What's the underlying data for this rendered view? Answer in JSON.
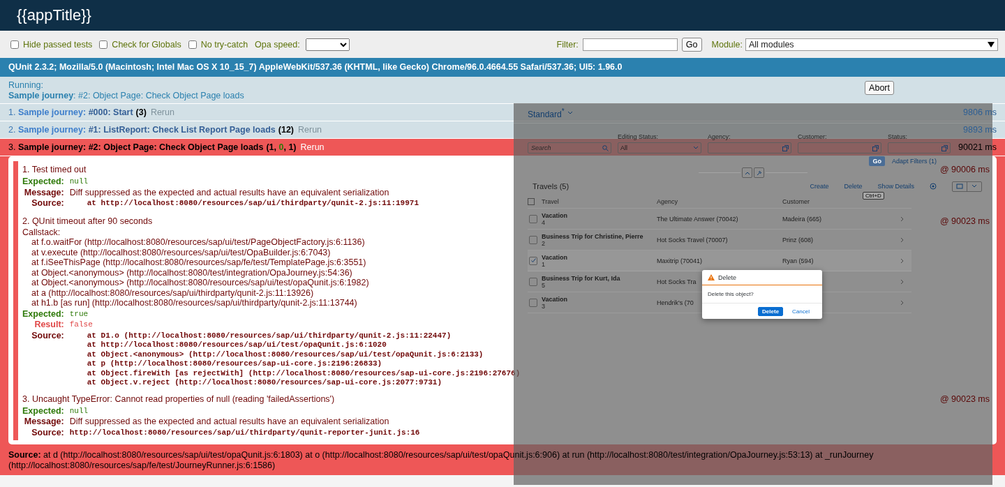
{
  "header": {
    "title": "{{appTitle}}"
  },
  "toolbar": {
    "options": [
      {
        "label": "Hide passed tests",
        "checked": false
      },
      {
        "label": "Check for Globals",
        "checked": false
      },
      {
        "label": "No try-catch",
        "checked": false
      }
    ],
    "speed_label": "Opa speed:",
    "filter_label": "Filter:",
    "filter_button": "Go",
    "module_label": "Module:",
    "module_value": "All modules"
  },
  "banner": {
    "user_agent": "QUnit 2.3.2; Mozilla/5.0 (Macintosh; Intel Mac OS X 10_15_7) AppleWebKit/537.36 (KHTML, like Gecko) Chrome/96.0.4664.55 Safari/537.36; UI5: 1.96.0"
  },
  "running": {
    "label": "Running:",
    "text": "**Sample journey**: #2: Object Page: Check Object Page loads",
    "abort_button": "Abort"
  },
  "tests": [
    {
      "number": "1.",
      "module": "Sample journey:",
      "name": "#000: Start",
      "counts": [
        {
          "text": "(3)",
          "kind": "total"
        }
      ],
      "rerun": "Rerun",
      "time": "9806 ms",
      "failed": false
    },
    {
      "number": "2.",
      "module": "Sample journey:",
      "name": "#1: ListReport: Check List Report Page loads",
      "counts": [
        {
          "text": "(12)",
          "kind": "total"
        }
      ],
      "rerun": "Rerun",
      "time": "9893 ms",
      "failed": false
    },
    {
      "number": "3.",
      "module": "Sample journey:",
      "name": "#2: Object Page: Check Object Page loads",
      "counts": [
        {
          "text": "(1, ",
          "kind": "failed"
        },
        {
          "text": "0",
          "kind": "passed"
        },
        {
          "text": ", 1)",
          "kind": "total"
        }
      ],
      "rerun": "Rerun",
      "time": "90021 ms",
      "failed": true,
      "assertions": [
        {
          "title": "1. Test timed out",
          "time": "@ 90006 ms",
          "fields": [
            {
              "kind": "expected",
              "label": "Expected:",
              "lines": [
                "null"
              ]
            },
            {
              "kind": "message",
              "label": "Message:",
              "lines": [
                "Diff suppressed as the expected and actual results have an equivalent serialization"
              ]
            },
            {
              "kind": "source",
              "label": "Source:",
              "indented": true,
              "lines": [
                "at http://localhost:8080/resources/sap/ui/thirdparty/qunit-2.js:11:19971"
              ]
            }
          ]
        },
        {
          "title": "2. QUnit timeout after 90 seconds",
          "time": "@ 90023 ms",
          "callstack_label": "Callstack:",
          "callstack": [
            "at f.o.waitFor (http://localhost:8080/resources/sap/ui/test/PageObjectFactory.js:6:1136)",
            "at v.execute (http://localhost:8080/resources/sap/ui/test/OpaBuilder.js:6:7043)",
            "at f.iSeeThisPage (http://localhost:8080/resources/sap/fe/test/TemplatePage.js:6:3551)",
            "at Object.<anonymous> (http://localhost:8080/test/integration/OpaJourney.js:54:36)",
            "at Object.<anonymous> (http://localhost:8080/resources/sap/ui/test/opaQunit.js:6:1982)",
            "at a (http://localhost:8080/resources/sap/ui/thirdparty/qunit-2.js:11:13926)",
            "at h1.b [as run] (http://localhost:8080/resources/sap/ui/thirdparty/qunit-2.js:11:13744)"
          ],
          "fields": [
            {
              "kind": "expected",
              "label": "Expected:",
              "lines": [
                "true"
              ]
            },
            {
              "kind": "result",
              "label": "Result:",
              "lines": [
                "false"
              ]
            },
            {
              "kind": "source",
              "label": "Source:",
              "indented": true,
              "lines": [
                "at D1.o (http://localhost:8080/resources/sap/ui/thirdparty/qunit-2.js:11:22447)",
                "at http://localhost:8080/resources/sap/ui/test/opaQunit.js:6:1020",
                "at Object.<anonymous> (http://localhost:8080/resources/sap/ui/test/opaQunit.js:6:2133)",
                "at p (http://localhost:8080/resources/sap-ui-core.js:2196:26833)",
                "at Object.fireWith [as rejectWith] (http://localhost:8080/resources/sap-ui-core.js:2196:27676)",
                "at Object.v.reject (http://localhost:8080/resources/sap-ui-core.js:2077:9731)"
              ]
            }
          ]
        },
        {
          "title": "3. Uncaught TypeError: Cannot read properties of null (reading 'failedAssertions')",
          "time": "@ 90023 ms",
          "fields": [
            {
              "kind": "expected",
              "label": "Expected:",
              "lines": [
                "null"
              ]
            },
            {
              "kind": "message",
              "label": "Message:",
              "lines": [
                "Diff suppressed as the expected and actual results have an equivalent serialization"
              ]
            },
            {
              "kind": "source",
              "label": "Source:",
              "indented": false,
              "lines": [
                "http://localhost:8080/resources/sap/ui/thirdparty/qunit-reporter-junit.js:16"
              ]
            }
          ]
        }
      ],
      "source": {
        "label": "Source:",
        "text": "at d (http://localhost:8080/resources/sap/ui/test/opaQunit.js:6:1803) at o (http://localhost:8080/resources/sap/ui/test/opaQunit.js:6:906) at run (http://localhost:8080/test/integration/OpaJourney.js:53:13) at _runJourney (http://localhost:8080/resources/sap/fe/test/JourneyRunner.js:6:1586)"
      }
    }
  ],
  "app": {
    "variant": "Standard$^{*}$",
    "filters": [
      {
        "kind": "search",
        "placeholder": "Search"
      },
      {
        "kind": "select",
        "label": "Editing Status:",
        "value": "All"
      },
      {
        "kind": "valuehelp",
        "label": "Agency:"
      },
      {
        "kind": "valuehelp",
        "label": "Customer:"
      },
      {
        "kind": "valuehelp",
        "label": "Status:"
      }
    ],
    "go_button": "Go",
    "adapt_filters": "Adapt Filters (1)",
    "table": {
      "title": "Travels (5)",
      "actions": [
        "Create",
        "Delete",
        "Show Details"
      ],
      "tooltip": "Ctrl+D",
      "columns": [
        "Travel",
        "Agency",
        "Customer"
      ],
      "rows": [
        {
          "title": "Vacation",
          "id": "4",
          "agency": "The Ultimate Answer (70042)",
          "customer": "Madeira (665)",
          "checked": false
        },
        {
          "title": "Business Trip for Christine, Pierre",
          "id": "2",
          "agency": "Hot Socks Travel (70007)",
          "customer": "Prinz (608)",
          "checked": false
        },
        {
          "title": "Vacation",
          "id": "1",
          "agency": "Maxitrip (70041)",
          "customer": "Ryan (594)",
          "checked": true
        },
        {
          "title": "Business Trip for Kurt, Ida",
          "id": "5",
          "agency": "Hot Socks Tra",
          "checked": false
        },
        {
          "title": "Vacation",
          "id": "3",
          "agency": "Hendrik's (70",
          "checked": false
        }
      ]
    },
    "dialog": {
      "title": "Delete",
      "message": "Delete this object?",
      "buttons": [
        {
          "label": "Delete",
          "kind": "emphasized"
        },
        {
          "label": "Cancel",
          "kind": "transparent"
        }
      ]
    }
  }
}
